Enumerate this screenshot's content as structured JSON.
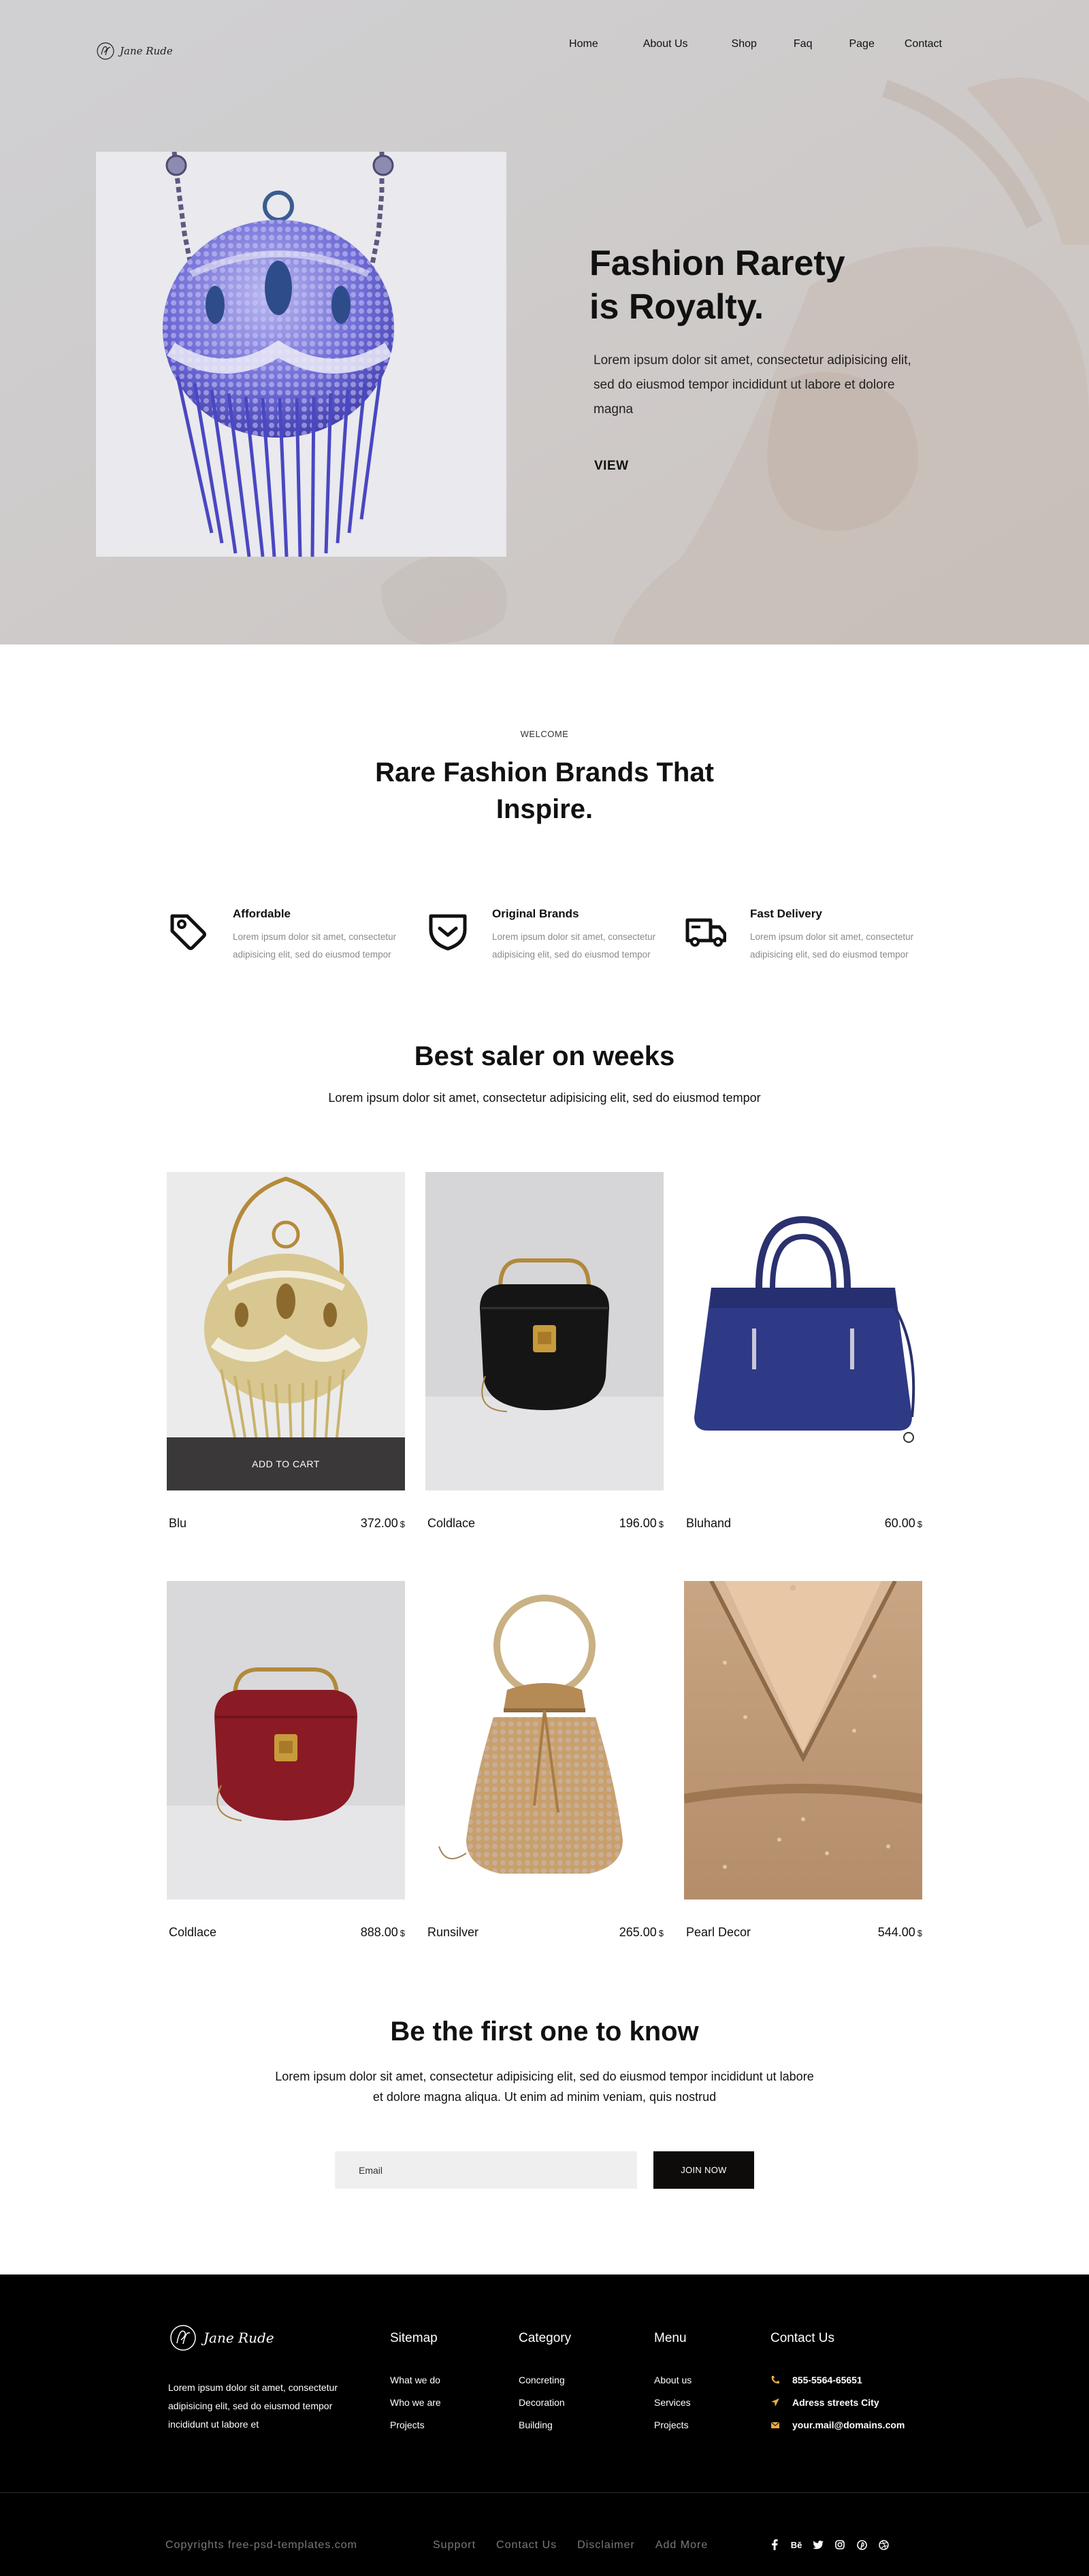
{
  "nav": {
    "logo_text": "Jane Rude",
    "items": [
      {
        "label": "Home"
      },
      {
        "label": "About Us"
      },
      {
        "label": "Shop"
      },
      {
        "label": "Faq"
      },
      {
        "label": "Page"
      },
      {
        "label": "Contact"
      }
    ]
  },
  "hero": {
    "title_line1": "Fashion Rarety",
    "title_line2": "is Royalty.",
    "text": "Lorem ipsum dolor sit amet, consectetur adipisicing elit, sed do eiusmod tempor incididunt ut labore et dolore magna",
    "cta": "VIEW",
    "background": "#d4d4d6"
  },
  "welcome": {
    "eyebrow": "WELCOME",
    "title": "Rare Fashion Brands That Inspire."
  },
  "features": [
    {
      "icon": "price-tag-icon",
      "title": "Affordable",
      "text": "Lorem ipsum dolor sit amet, consectetur adipisicing elit, sed do eiusmod tempor"
    },
    {
      "icon": "shield-check-icon",
      "title": "Original Brands",
      "text": "Lorem ipsum dolor sit amet, consectetur adipisicing elit, sed do eiusmod tempor"
    },
    {
      "icon": "delivery-truck-icon",
      "title": "Fast Delivery",
      "text": "Lorem ipsum dolor sit amet, consectetur adipisicing elit, sed do eiusmod tempor"
    }
  ],
  "best": {
    "title": "Best saler on weeks",
    "subtitle": "Lorem ipsum dolor sit amet, consectetur adipisicing elit, sed do eiusmod tempor"
  },
  "products": [
    {
      "name": "Blu",
      "price": "372.00",
      "currency": "$",
      "add_to_cart": "ADD TO CART"
    },
    {
      "name": "Coldlace",
      "price": "196.00",
      "currency": "$"
    },
    {
      "name": "Bluhand",
      "price": "60.00",
      "currency": "$"
    },
    {
      "name": "Coldlace",
      "price": "888.00",
      "currency": "$"
    },
    {
      "name": "Runsilver",
      "price": "265.00",
      "currency": "$"
    },
    {
      "name": "Pearl Decor",
      "price": "544.00",
      "currency": "$"
    }
  ],
  "newsletter": {
    "title": "Be the first one to know",
    "text": "Lorem ipsum dolor sit amet, consectetur adipisicing elit, sed do eiusmod tempor incididunt ut labore et dolore magna aliqua. Ut enim ad minim veniam, quis nostrud",
    "email_placeholder": "Email",
    "button": "JOIN NOW"
  },
  "footer": {
    "logo_text": "Jane Rude",
    "about": "Lorem ipsum dolor sit amet, consectetur adipisicing elit, sed do eiusmod tempor incididunt ut labore et",
    "columns": [
      {
        "title": "Sitemap",
        "links": [
          "What we do",
          "Who we are",
          "Projects"
        ]
      },
      {
        "title": "Category",
        "links": [
          "Concreting",
          "Decoration",
          "Building"
        ]
      },
      {
        "title": "Menu",
        "links": [
          "About us",
          "Services",
          "Projects"
        ]
      }
    ],
    "contact": {
      "title": "Contact Us",
      "phone": "855-5564-65651",
      "address": "Adress streets City",
      "email": "your.mail@domains.com",
      "accent": "#e8a84a"
    },
    "copyright": "Copyrights free-psd-templates.com",
    "bottom_links": [
      "Support",
      "Contact Us",
      "Disclaimer",
      "Add More"
    ],
    "social": [
      "facebook-icon",
      "behance-icon",
      "twitter-icon",
      "instagram-icon",
      "pinterest-icon",
      "dribbble-icon"
    ],
    "behance_label": "Bē"
  }
}
